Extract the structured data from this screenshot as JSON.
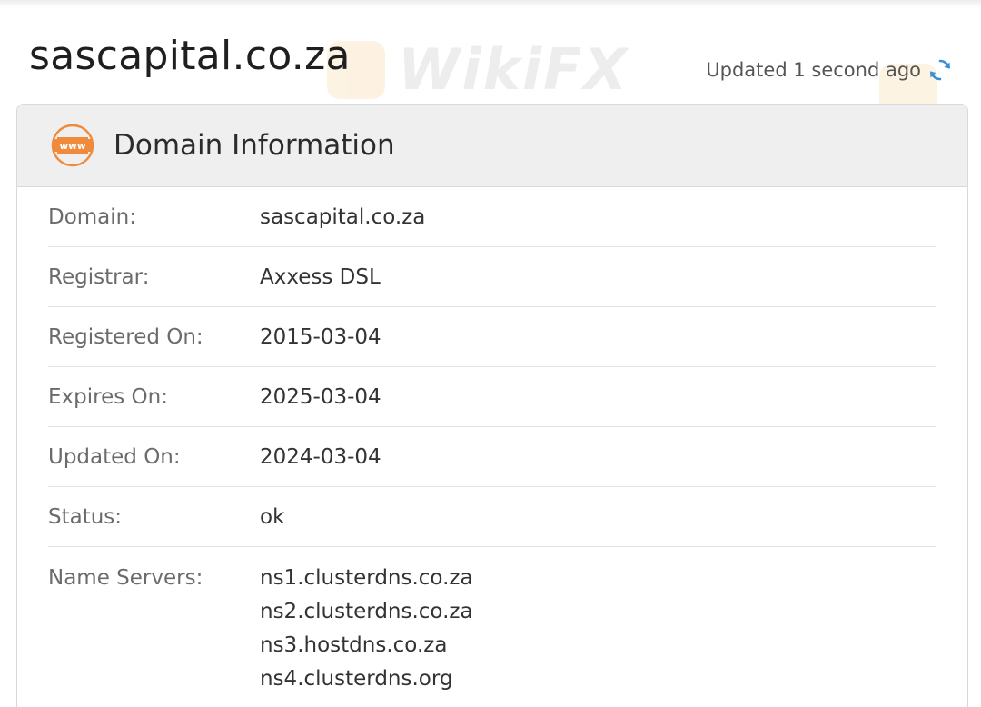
{
  "page": {
    "title": "sascapital.co.za",
    "updated_text": "Updated 1 second ago",
    "refresh_icon": "refresh-icon"
  },
  "card": {
    "title": "Domain Information",
    "icon": "www-icon",
    "icon_text": "www",
    "accent_color": "#f08a3c"
  },
  "rows": [
    {
      "label": "Domain:",
      "value": "sascapital.co.za"
    },
    {
      "label": "Registrar:",
      "value": "Axxess DSL"
    },
    {
      "label": "Registered On:",
      "value": "2015-03-04"
    },
    {
      "label": "Expires On:",
      "value": "2025-03-04"
    },
    {
      "label": "Updated On:",
      "value": "2024-03-04"
    },
    {
      "label": "Status:",
      "value": "ok"
    }
  ],
  "name_servers": {
    "label": "Name Servers:",
    "values": [
      "ns1.clusterdns.co.za",
      "ns2.clusterdns.co.za",
      "ns3.hostdns.co.za",
      "ns4.clusterdns.org"
    ]
  },
  "watermark": {
    "text": "WikiFX"
  }
}
